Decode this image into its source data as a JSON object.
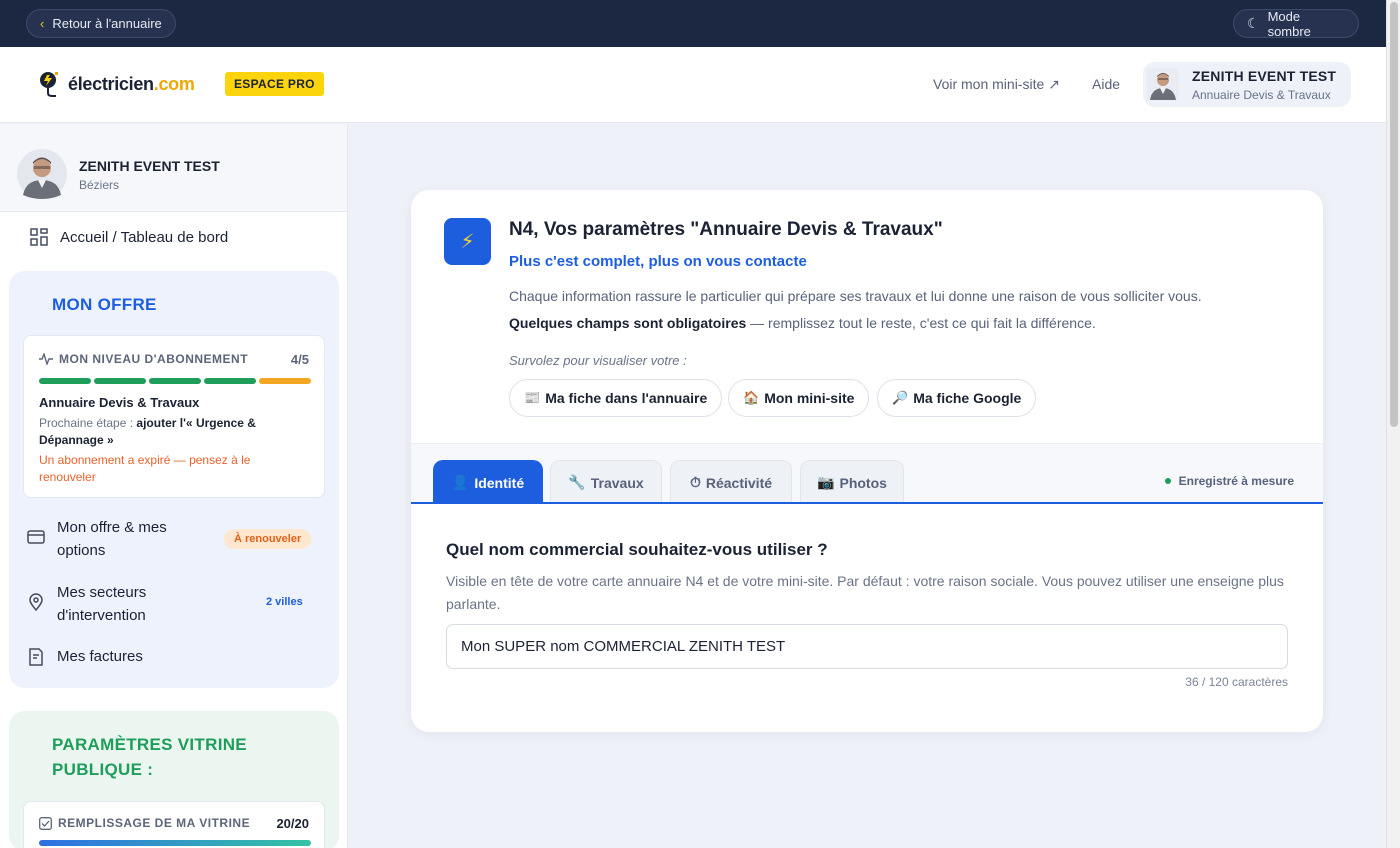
{
  "topbar": {
    "back_label": "Retour à l'annuaire",
    "dark_mode_label": "Mode sombre"
  },
  "header": {
    "logo_main": "électricien",
    "logo_domain": ".com",
    "badge": "ESPACE PRO",
    "minisite_link": "Voir mon mini-site ↗",
    "help_link": "Aide",
    "user_name": "ZENITH EVENT TEST",
    "user_plan": "Annuaire Devis & Travaux"
  },
  "sidebar": {
    "profile_name": "ZENITH EVENT TEST",
    "profile_city": "Béziers",
    "home_label": "Accueil / Tableau de bord",
    "offer": {
      "title": "MON OFFRE",
      "level_label": "MON NIVEAU D'ABONNEMENT",
      "level_value": "4/5",
      "level_current": 4,
      "level_max": 5,
      "plan_name": "Annuaire Devis & Travaux",
      "next_prefix": "Prochaine étape : ",
      "next_step": "ajouter l'« Urgence & Dépannage »",
      "warning": "Un abonnement a expiré — pensez à le renouveler",
      "bar_colors": [
        "#1e9e5a",
        "#1e9e5a",
        "#1e9e5a",
        "#1e9e5a",
        "#f5a623"
      ]
    },
    "items": [
      {
        "label": "Mon offre & mes options",
        "badge": "À renouveler"
      },
      {
        "label": "Mes secteurs d'intervention",
        "badge": "2 villes"
      },
      {
        "label": "Mes factures"
      }
    ],
    "vitrine": {
      "title": "PARAMÈTRES VITRINE PUBLIQUE :",
      "fill_label": "REMPLISSAGE DE MA VITRINE",
      "fill_value": "20/20",
      "fill_fraction": 1.0
    }
  },
  "main": {
    "title": "N4, Vos paramètres \"Annuaire Devis & Travaux\"",
    "subtitle": "Plus c'est complet, plus on vous contacte",
    "paragraph1": "Chaque information rassure le particulier qui prépare ses travaux et lui donne une raison de vous solliciter vous.",
    "paragraph2_bold": "Quelques champs sont obligatoires",
    "paragraph2_rest": " — remplissez tout le reste, c'est ce qui fait la différence.",
    "hover_hint": "Survolez pour visualiser votre :",
    "chips": [
      {
        "emoji": "📰",
        "label": "Ma fiche dans l'annuaire"
      },
      {
        "emoji": "🏠",
        "label": "Mon mini-site"
      },
      {
        "emoji": "🔎",
        "label": "Ma fiche Google"
      }
    ],
    "tabs": [
      {
        "emoji": "👤",
        "label": "Identité"
      },
      {
        "emoji": "🔧",
        "label": "Travaux"
      },
      {
        "emoji": "⏱",
        "label": "Réactivité"
      },
      {
        "emoji": "📷",
        "label": "Photos"
      }
    ],
    "saved_label": "Enregistré à mesure",
    "question": "Quel nom commercial souhaitez-vous utiliser ?",
    "help": "Visible en tête de votre carte annuaire N4 et de votre mini-site. Par défaut : votre raison sociale. Vous pouvez utiliser une enseigne plus parlante.",
    "input_value": "Mon SUPER nom COMMERCIAL ZENITH TEST",
    "char_count": "36 / 120 caractères"
  },
  "colors": {
    "brand_blue": "#1d5ede",
    "brand_yellow": "#fcd40e",
    "success_green": "#1e9e5a",
    "warning_orange": "#e8622a",
    "dark_nav": "#1c2741"
  }
}
